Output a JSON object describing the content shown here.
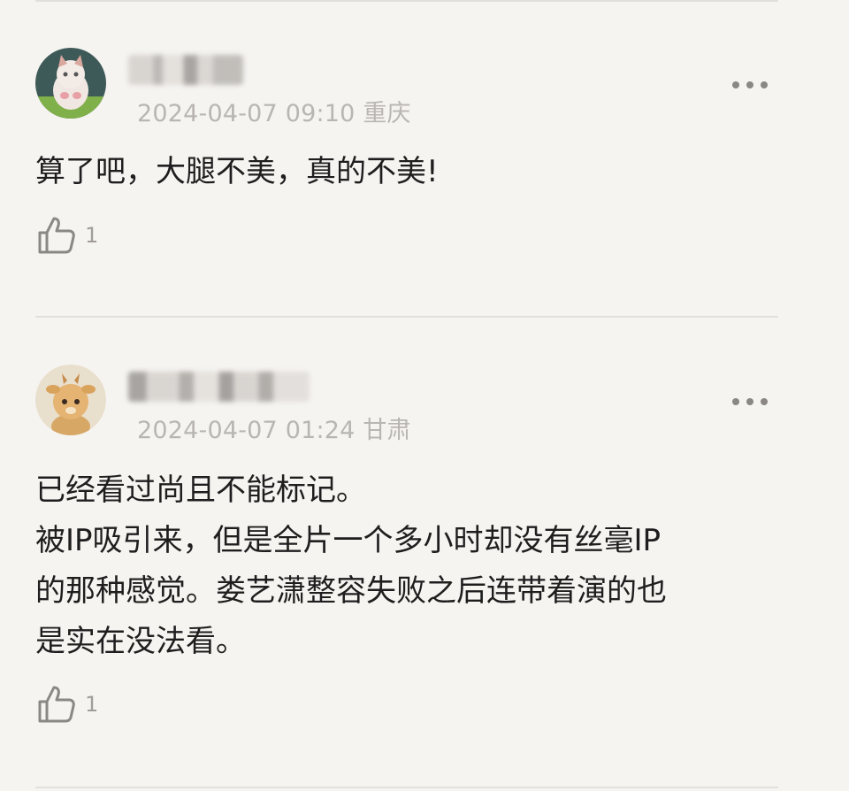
{
  "comments": [
    {
      "avatar_icon": "kitten-avatar",
      "timestamp": "2024-04-07 09:10",
      "location": "重庆",
      "paragraphs": [
        "算了吧，大腿不美，真的不美!"
      ],
      "likes": "1",
      "more_icon": "more-dots-icon",
      "like_icon": "thumbs-up-icon"
    },
    {
      "avatar_icon": "deer-toy-avatar",
      "timestamp": "2024-04-07 01:24",
      "location": "甘肃",
      "paragraphs": [
        "已经看过尚且不能标记。",
        "被IP吸引来，但是全片一个多小时却没有丝毫IP",
        "的那种感觉。娄艺潇整容失败之后连带着演的也",
        "是实在没法看。"
      ],
      "likes": "1",
      "more_icon": "more-dots-icon",
      "like_icon": "thumbs-up-icon"
    }
  ],
  "colors": {
    "background": "#f6f4f1",
    "meta_text": "#b9b6b2",
    "divider": "#e3e0dc",
    "icon": "#8a8784"
  }
}
